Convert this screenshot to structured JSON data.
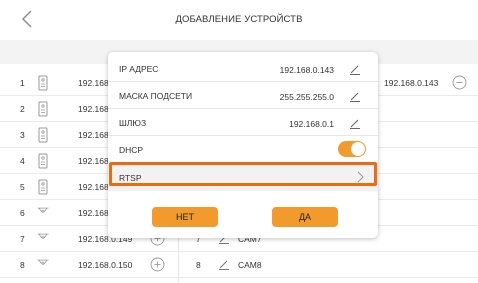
{
  "header": {
    "title": "ДОБАВЛЕНИЕ УСТРОЙСТВ"
  },
  "icons": {
    "back": "chevron-left-icon",
    "device": "intercom-panel-icon",
    "camera": "camera-icon",
    "add": "plus-circle-icon",
    "remove": "minus-circle-icon",
    "edit": "pencil-icon"
  },
  "left_rows": [
    {
      "num": "1",
      "ip": "192.168.",
      "device": "panel"
    },
    {
      "num": "2",
      "ip": "192.168.",
      "device": "panel"
    },
    {
      "num": "3",
      "ip": "192.168.",
      "device": "panel"
    },
    {
      "num": "4",
      "ip": "192.168.",
      "device": "panel"
    },
    {
      "num": "5",
      "ip": "192.168.",
      "device": "panel"
    },
    {
      "num": "6",
      "ip": "192.168.",
      "device": "camera"
    },
    {
      "num": "7",
      "ip": "192.168.0.149",
      "device": "camera"
    },
    {
      "num": "8",
      "ip": "192.168.0.150",
      "device": "camera"
    }
  ],
  "right_rows": {
    "row1_ip": "192.168.0.143",
    "row7_num": "7",
    "row7_name": "CAM7",
    "row8_num": "8",
    "row8_name": "CAM8"
  },
  "dialog": {
    "ip_label": "IP АДРЕС",
    "ip_value": "192.168.0.143",
    "mask_label": "МАСКА ПОДСЕТИ",
    "mask_value": "255.255.255.0",
    "gateway_label": "ШЛЮЗ",
    "gateway_value": "192.168.0.1",
    "dhcp_label": "DHCP",
    "dhcp_on": true,
    "rtsp_label": "RTSP",
    "no_label": "НЕТ",
    "yes_label": "ДА"
  },
  "colors": {
    "accent": "#f39a2c",
    "highlight": "#ee6a12"
  }
}
